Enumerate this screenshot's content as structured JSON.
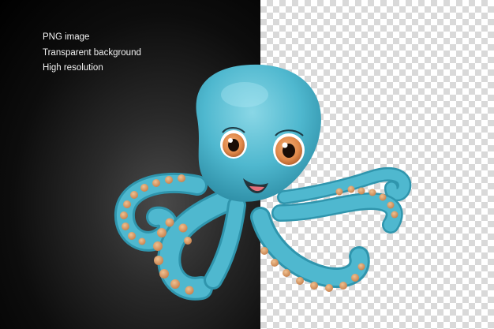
{
  "features": [
    "PNG image",
    "Transparent background",
    "High resolution"
  ],
  "illustration": {
    "subject": "cartoon-octopus",
    "body_color": "#4fb8cf",
    "sucker_color": "#d99a62",
    "eye_color": "#e0894a"
  }
}
